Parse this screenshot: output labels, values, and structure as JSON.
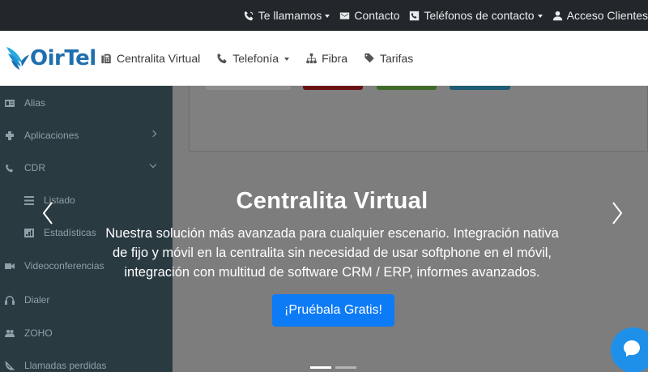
{
  "topbar": {
    "links": [
      {
        "label": "Te llamamos",
        "icon": "phone-volume-icon",
        "dropdown": true
      },
      {
        "label": "Contacto",
        "icon": "envelope-icon",
        "dropdown": false
      },
      {
        "label": "Teléfonos de contacto",
        "icon": "phone-square-icon",
        "dropdown": true
      },
      {
        "label": "Acceso Clientes",
        "icon": "user-icon",
        "dropdown": false
      }
    ]
  },
  "brand": {
    "name": "OirTel",
    "color": "#1f6fae"
  },
  "nav": {
    "items": [
      {
        "label": "Centralita Virtual",
        "icon": "fax-icon"
      },
      {
        "label": "Telefonía",
        "icon": "phone-icon",
        "dropdown": true
      },
      {
        "label": "Fibra",
        "icon": "network-icon"
      },
      {
        "label": "Tarifas",
        "icon": "tags-icon"
      }
    ]
  },
  "sidebar": {
    "items": [
      {
        "label": "Alias",
        "icon": "id-card-icon"
      },
      {
        "label": "Aplicaciones",
        "icon": "puzzle-icon",
        "arrow": "right"
      },
      {
        "label": "CDR",
        "icon": "phone-icon",
        "arrow": "down"
      },
      {
        "label": "Listado",
        "icon": "list-icon",
        "sub": true
      },
      {
        "label": "Estadísticas",
        "icon": "chart-icon",
        "sub": true
      },
      {
        "label": "Videoconferencias",
        "icon": "video-icon"
      },
      {
        "label": "Dialer",
        "icon": "headset-icon"
      },
      {
        "label": "ZOHO",
        "icon": "users-icon"
      },
      {
        "label": "Llamadas perdidas",
        "icon": "phone-slash-icon"
      }
    ]
  },
  "slide": {
    "title": "Centralita Virtual",
    "text_lines": [
      "Nuestra solución más avanzada para cualquier escenario. Integración nativa",
      "de fijo y móvil en la centralita sin necesidad de usar softphone en el móvil,",
      "integración con multitud de software CRM / ERP, informes avanzados."
    ],
    "button_label": "¡Pruébala Gratis!",
    "indicators": 2,
    "active_indicator": 1
  },
  "colors": {
    "topbar": "#23272b",
    "accent_button": "#0d7bf6",
    "chat": "#1e90ea"
  }
}
